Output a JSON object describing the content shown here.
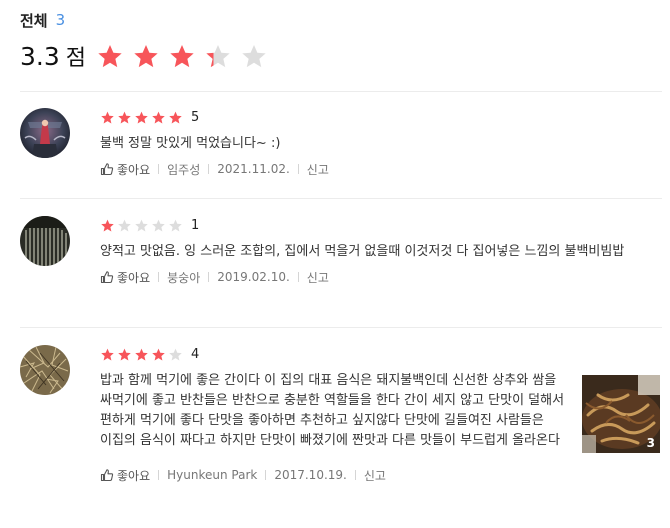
{
  "summary": {
    "total_label": "전체",
    "total_count": "3",
    "score": "3.3",
    "score_unit": "점",
    "stars_filled": 3.3,
    "star_color": "#f7555a",
    "star_empty_color": "#dddddd"
  },
  "reviews": [
    {
      "rating": 5,
      "rating_label": "5",
      "text": "불백 정말 맛있게 먹었습니다~ :)",
      "like_label": "좋아요",
      "author": "임주성",
      "date": "2021.11.02.",
      "report_label": "신고",
      "avatar_icon": "user-photo-avatar"
    },
    {
      "rating": 1,
      "rating_label": "1",
      "text": "양적고 맛없음. 잉 스러운 조합의, 집에서 먹을거 없을때 이것저것 다 집어넣은 느낌의 불백비빔밥",
      "like_label": "좋아요",
      "author": "붕숭아",
      "date": "2019.02.10.",
      "report_label": "신고",
      "avatar_icon": "user-photo-avatar"
    },
    {
      "rating": 4,
      "rating_label": "4",
      "text": "밥과 함께 먹기에 좋은 간이다 이 집의 대표 음식은 돼지불백인데 신선한 상추와 쌈을 싸먹기에 좋고 반찬들은 반찬으로 충분한 역할들을 한다 간이 세지 않고 단맛이 덜해서 편하게 먹기에 좋다 단맛을 좋아하면 추천하고 싶지않다 단맛에 길들여진 사람들은 이집의 음식이 짜다고 하지만 단맛이 빠졌기에 짠맛과 다른 맛들이 부드럽게 올라온다",
      "like_label": "좋아요",
      "author": "Hyunkeun Park",
      "date": "2017.10.19.",
      "report_label": "신고",
      "avatar_icon": "user-photo-avatar",
      "photo_count": "3"
    }
  ]
}
